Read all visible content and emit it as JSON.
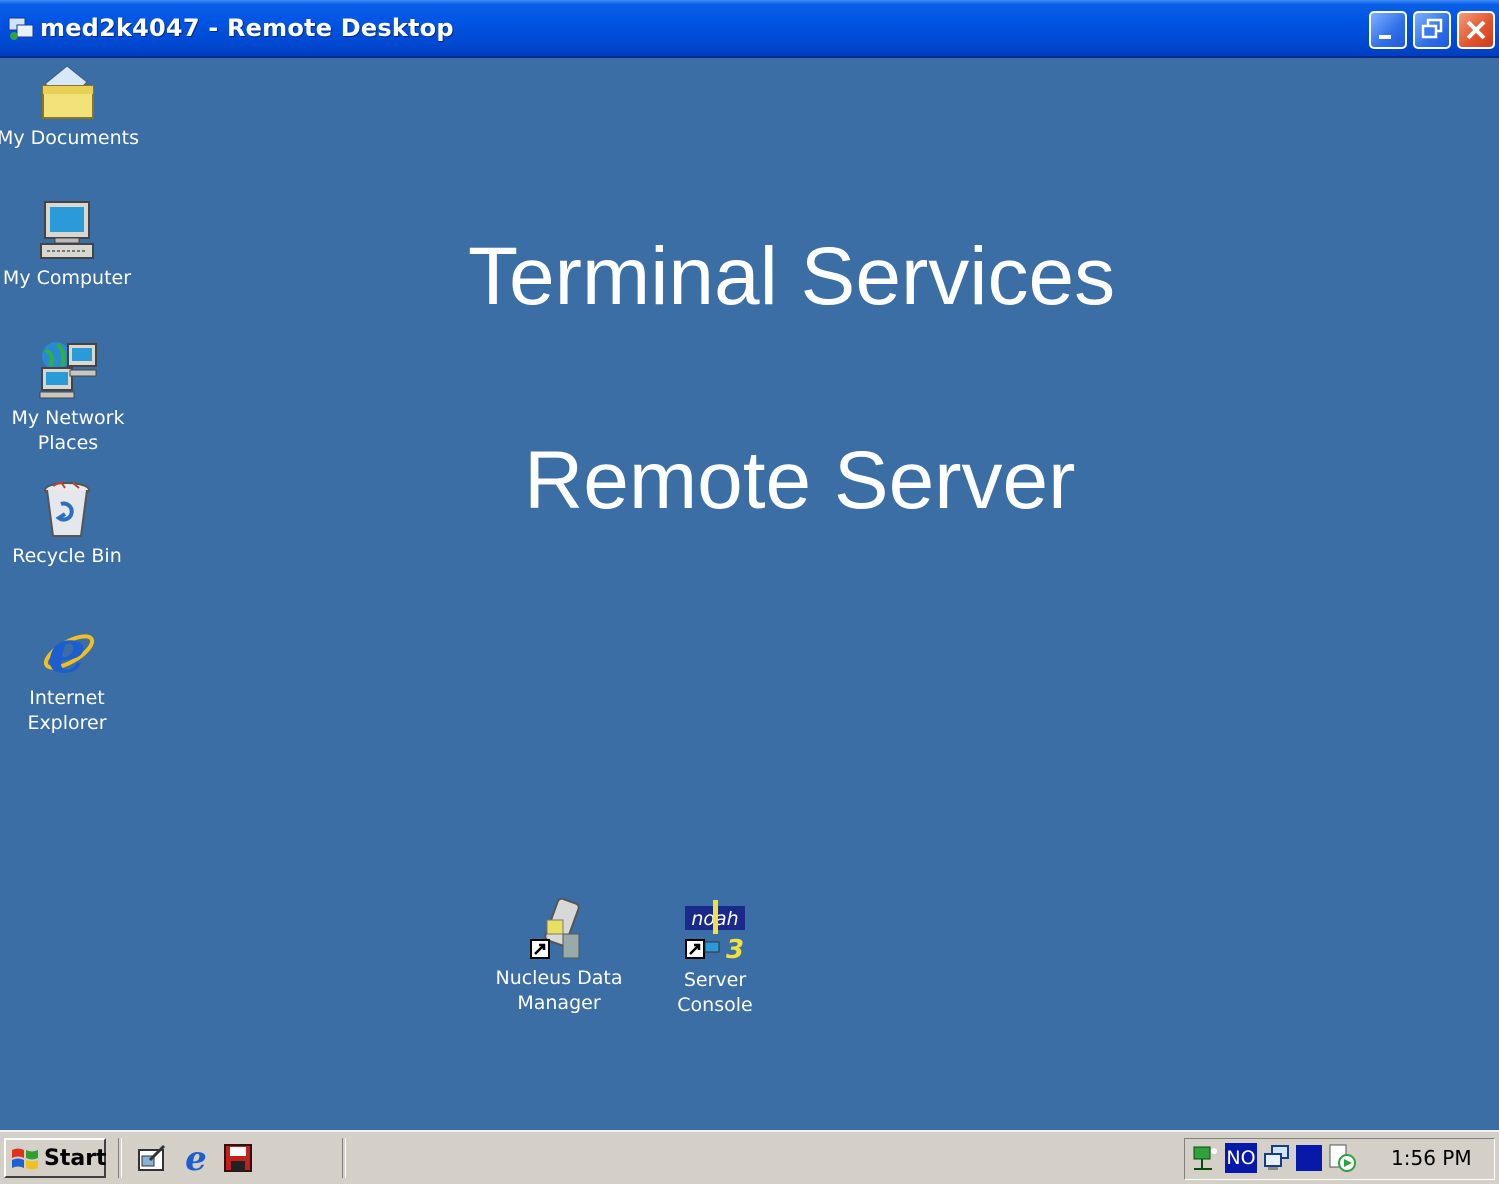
{
  "window": {
    "title": "med2k4047 - Remote Desktop",
    "controls": [
      "minimize",
      "restore",
      "close"
    ]
  },
  "desktop": {
    "background_color": "#3a6ea5",
    "headline_1": "Terminal Services",
    "headline_2": "Remote Server",
    "icons": [
      {
        "label_1": "My Documents",
        "label_2": "",
        "icon": "my-documents-icon"
      },
      {
        "label_1": "My Computer",
        "label_2": "",
        "icon": "my-computer-icon"
      },
      {
        "label_1": "My Network",
        "label_2": "Places",
        "icon": "network-places-icon"
      },
      {
        "label_1": "Recycle Bin",
        "label_2": "",
        "icon": "recycle-bin-icon"
      },
      {
        "label_1": "Internet",
        "label_2": "Explorer",
        "icon": "internet-explorer-icon"
      },
      {
        "label_1": "Nucleus Data",
        "label_2": "Manager",
        "icon": "nucleus-data-manager-icon"
      },
      {
        "label_1": "Server",
        "label_2": "Console",
        "icon": "noah-server-console-icon"
      }
    ]
  },
  "taskbar": {
    "start_label": "Start",
    "quick_launch": [
      "show-desktop-icon",
      "internet-explorer-icon",
      "save-icon"
    ],
    "tray_icons": [
      "network-icon",
      "language-no-icon",
      "computer-icon",
      "monitor-icon",
      "media-icon"
    ],
    "tray_language": "NO",
    "clock": "1:56 PM"
  }
}
